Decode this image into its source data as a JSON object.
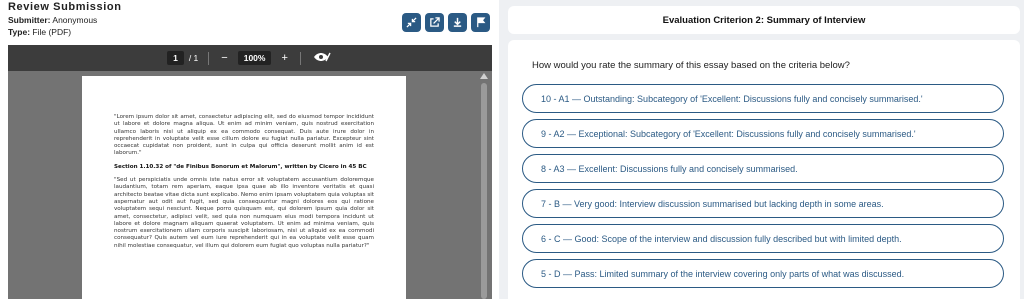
{
  "review": {
    "title": "Review Submission",
    "submitter_label": "Submitter:",
    "submitter_value": "Anonymous",
    "type_label": "Type:",
    "type_value": "File (PDF)"
  },
  "actions": [
    {
      "icon": "collapse-icon"
    },
    {
      "icon": "open-external-icon"
    },
    {
      "icon": "download-icon"
    },
    {
      "icon": "flag-icon"
    }
  ],
  "viewer": {
    "page_current": "1",
    "page_sep": "/ 1",
    "zoom_out": "−",
    "zoom": "100%",
    "zoom_in": "+",
    "doc_paragraph_1": "\"Lorem ipsum dolor sit amet, consectetur adipiscing elit, sed do eiusmod tempor incididunt ut labore et dolore magna aliqua. Ut enim ad minim veniam, quis nostrud exercitation ullamco laboris nisi ut aliquip ex ea commodo consequat. Duis aute irure dolor in reprehenderit in voluptate velit esse cillum dolore eu fugiat nulla pariatur. Excepteur sint occaecat cupidatat non proident, sunt in culpa qui officia deserunt mollit anim id est laborum.\"",
    "doc_section": "Section 1.10.32 of \"de Finibus Bonorum et Malorum\", written by Cicero in 45 BC",
    "doc_paragraph_2": "\"Sed ut perspiciatis unde omnis iste natus error sit voluptatem accusantium doloremque laudantium, totam rem aperiam, eaque ipsa quae ab illo inventore veritatis et quasi architecto beatae vitae dicta sunt explicabo. Nemo enim ipsam voluptatem quia voluptas sit aspernatur aut odit aut fugit, sed quia consequuntur magni dolores eos qui ratione voluptatem sequi nesciunt. Neque porro quisquam est, qui dolorem ipsum quia dolor sit amet, consectetur, adipisci velit, sed quia non numquam eius modi tempora incidunt ut labore et dolore magnam aliquam quaerat voluptatem. Ut enim ad minima veniam, quis nostrum exercitationem ullam corporis suscipit laboriosam, nisi ut aliquid ex ea commodi consequatur? Quis autem vel eum iure reprehenderit qui in ea voluptate velit esse quam nihil molestiae consequatur, vel illum qui dolorem eum fugiat quo voluptas nulla pariatur?\""
  },
  "criterion": {
    "title": "Evaluation Criterion 2: Summary of Interview",
    "question": "How would you rate the summary of this essay based on the criteria below?",
    "options": [
      "10 - A1 — Outstanding: Subcategory of 'Excellent: Discussions fully and concisely summarised.'",
      "9 - A2 — Exceptional: Subcategory of 'Excellent: Discussions fully and concisely summarised.'",
      "8 - A3 — Excellent: Discussions fully and concisely summarised.",
      "7 - B — Very good: Interview discussion summarised but lacking depth in some areas.",
      "6 - C — Good: Scope of the interview and discussion fully described but with limited depth.",
      "5 - D — Pass: Limited summary of the interview covering only parts of what was discussed."
    ]
  },
  "colors": {
    "accent": "#2b5a84",
    "viewer_toolbar": "#3c3c3c",
    "viewer_bg": "#737373"
  }
}
